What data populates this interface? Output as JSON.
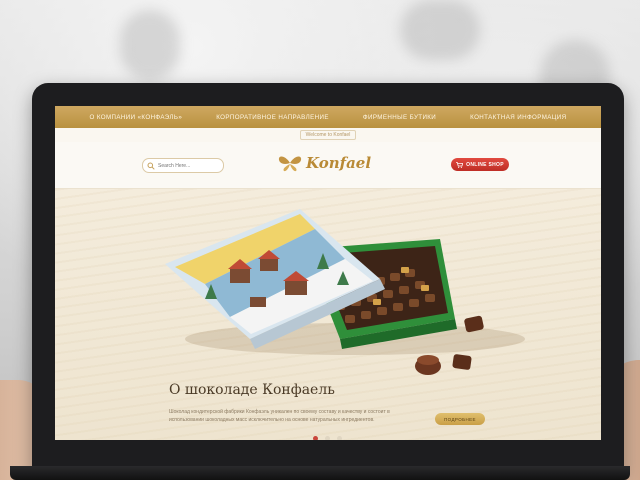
{
  "nav": {
    "items": [
      "О КОМПАНИИ «КОНФАЭЛЬ»",
      "КОРПОРАТИВНОЕ НАПРАВЛЕНИЕ",
      "ФИРМЕННЫЕ БУТИКИ",
      "КОНТАКТНАЯ ИНФОРМАЦИЯ"
    ]
  },
  "welcome": "Welcome to Konfael",
  "search": {
    "placeholder": "Search Here..."
  },
  "logo": {
    "text": "Konfael"
  },
  "shop_button": "ONLINE SHOP",
  "hero": {
    "title": "О шоколаде Конфаель",
    "text": "Шоколад кондитерской фабрики Конфаэль уникален по своему составу и качеству и состоит в использовании шоколадных масс исключительно на основе натуральных ингредиентов.",
    "button": "ПОДРОБНЕЕ",
    "slides": 3,
    "active_slide": 1
  },
  "colors": {
    "gold": "#c9a255",
    "red": "#c9463c",
    "box_green": "#2f8f3a"
  }
}
